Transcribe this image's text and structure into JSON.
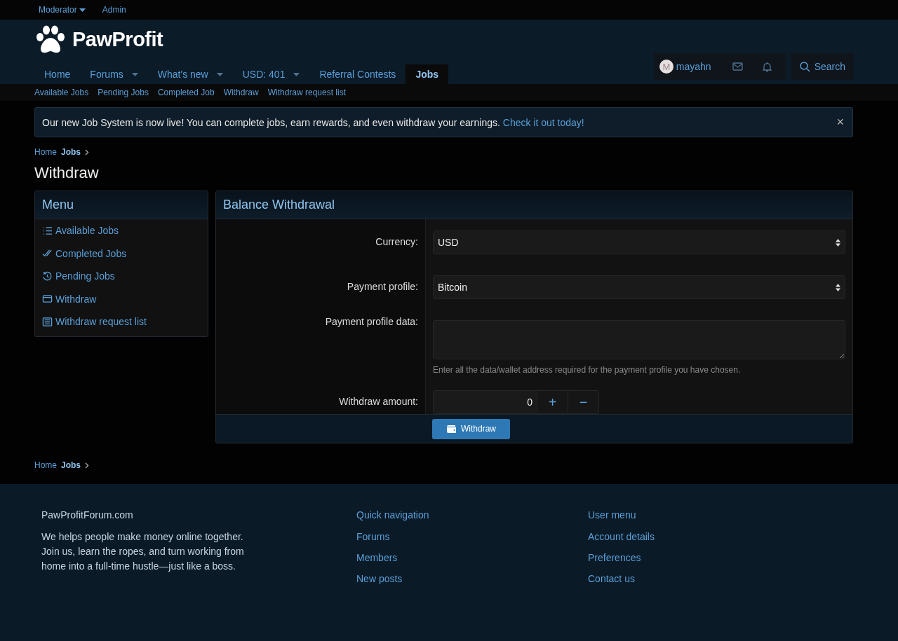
{
  "staff_bar": [
    {
      "label": "Moderator",
      "dropdown": true
    },
    {
      "label": "Admin",
      "dropdown": false
    }
  ],
  "logo": {
    "text": "PawProfit"
  },
  "nav": [
    {
      "label": "Home",
      "dropdown": false,
      "selected": false
    },
    {
      "label": "Forums",
      "dropdown": true,
      "selected": false
    },
    {
      "label": "What's new",
      "dropdown": true,
      "selected": false
    },
    {
      "label": "USD: 401",
      "dropdown": true,
      "selected": false
    },
    {
      "label": "Referral Contests",
      "dropdown": false,
      "selected": false
    },
    {
      "label": "Jobs",
      "dropdown": false,
      "selected": true
    }
  ],
  "user": {
    "avatar_letter": "M",
    "name": "mayahn"
  },
  "search": {
    "label": "Search"
  },
  "sub_nav": [
    "Available Jobs",
    "Pending Jobs",
    "Completed Job",
    "Withdraw",
    "Withdraw request list"
  ],
  "notice": {
    "text": "Our new Job System is now live! You can complete jobs, earn rewards, and even withdraw your earnings.",
    "link": "Check it out today!",
    "close": "×"
  },
  "breadcrumb": [
    {
      "label": "Home"
    },
    {
      "label": "Jobs"
    }
  ],
  "page_title": "Withdraw",
  "menu": {
    "title": "Menu",
    "items": [
      {
        "label": "Available Jobs",
        "kind": "list"
      },
      {
        "label": "Completed Jobs",
        "kind": "check"
      },
      {
        "label": "Pending Jobs",
        "kind": "history"
      },
      {
        "label": "Withdraw",
        "kind": "wallet"
      },
      {
        "label": "Withdraw request list",
        "kind": "table"
      }
    ]
  },
  "form": {
    "title": "Balance Withdrawal",
    "rows": [
      {
        "label": "Currency:",
        "kind": "select",
        "value": "USD"
      },
      {
        "label": "Payment profile:",
        "kind": "select",
        "value": "Bitcoin"
      },
      {
        "label": "Payment profile data:",
        "kind": "textarea",
        "hint": "Enter all the data/wallet address required for the payment profile you have chosen."
      },
      {
        "label": "Withdraw amount:",
        "kind": "number",
        "value": "0",
        "plus": "+",
        "minus": "−"
      }
    ],
    "submit": "Withdraw"
  },
  "breadcrumb_bottom": [
    {
      "label": "Home"
    },
    {
      "label": "Jobs"
    }
  ],
  "footer": {
    "about": {
      "title": "PawProfitForum.com",
      "text": "We helps people make money online together. Join us, learn the ropes, and turn working from home into a full-time hustle—just like a boss."
    },
    "columns": [
      {
        "title": "Quick navigation",
        "links": [
          "Forums",
          "Members",
          "New posts"
        ]
      },
      {
        "title": "User menu",
        "links": [
          "Account details",
          "Preferences",
          "Contact us"
        ]
      }
    ]
  }
}
